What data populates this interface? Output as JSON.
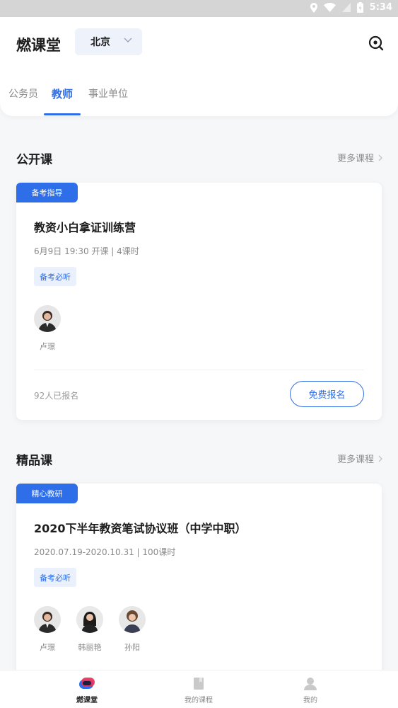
{
  "status_bar": {
    "time": "5:34"
  },
  "header": {
    "app_title": "燃课堂",
    "city": "北京"
  },
  "tabs": [
    {
      "label": "公务员",
      "active": false
    },
    {
      "label": "教师",
      "active": true
    },
    {
      "label": "事业单位",
      "active": false
    }
  ],
  "sections": {
    "open": {
      "title": "公开课",
      "more": "更多课程",
      "course": {
        "badge": "备考指导",
        "title": "教资小白拿证训练营",
        "meta": "6月9日 19:30 开课 | 4课时",
        "tag": "备考必听",
        "teachers": [
          "卢璟"
        ],
        "enrolled": "92人已报名",
        "cta": "免费报名"
      }
    },
    "premium": {
      "title": "精品课",
      "more": "更多课程",
      "course": {
        "badge": "精心教研",
        "title": "2020下半年教资笔试协议班（中学中职）",
        "meta": "2020.07.19-2020.10.31 | 100课时",
        "tag": "备考必听",
        "teachers": [
          "卢璟",
          "韩丽艳",
          "孙阳"
        ]
      }
    }
  },
  "bottom_nav": [
    {
      "label": "燃课堂",
      "icon": "ranketang-icon",
      "active": true
    },
    {
      "label": "我的课程",
      "icon": "my-courses-icon",
      "active": false
    },
    {
      "label": "我的",
      "icon": "profile-icon",
      "active": false
    }
  ],
  "colors": {
    "accent": "#2f6ee9",
    "tag_bg": "#eaf1fd",
    "nav_active": "#e8305a"
  }
}
